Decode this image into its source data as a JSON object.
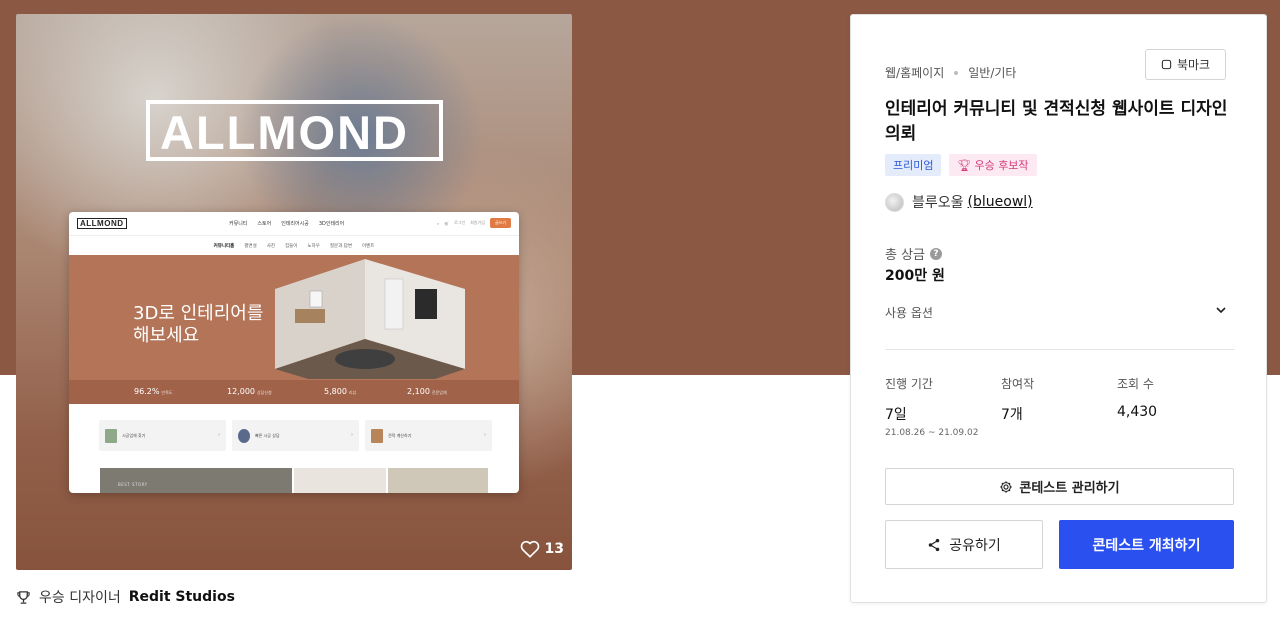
{
  "preview": {
    "logo": "ALLMOND",
    "mock": {
      "logo": "ALLMOND",
      "menu": [
        "커뮤니티",
        "스토어",
        "인테리어시공",
        "3D인테리어"
      ],
      "nav_right": [
        "로그인",
        "회원가입"
      ],
      "cta": "글쓰기",
      "submenu": [
        "커뮤니티홈",
        "평면설",
        "사진",
        "집들이",
        "노하우",
        "질문과 답변",
        "이벤트"
      ],
      "hero_title": "3D로 인테리어를\n해보세요",
      "stats": [
        {
          "value": "96.2%",
          "unit": "만족도"
        },
        {
          "value": "12,000",
          "unit": "상담신청"
        },
        {
          "value": "5,800",
          "unit": "리뷰"
        },
        {
          "value": "2,100",
          "unit": "전문업체"
        }
      ],
      "cards": [
        {
          "label": "시공업체 찾기"
        },
        {
          "label": "빠른 시공 상담"
        },
        {
          "label": "견적 계산하기"
        }
      ],
      "thumb_label": "BEST STORY"
    },
    "likes": "13"
  },
  "designer": {
    "prefix": "우승 디자이너",
    "name": "Redit Studios"
  },
  "panel": {
    "categories": [
      "웹/홈페이지",
      "일반/기타"
    ],
    "bookmark_label": "북마크",
    "title": "인테리어 커뮤니티 및 견적신청 웹사이트 디자인 의뢰",
    "badges": {
      "premium": "프리미엄",
      "award": "우승 후보작"
    },
    "author": {
      "name": "블루오울",
      "handle": "(blueowl)"
    },
    "prize_label": "총 상금",
    "prize_value": "200만 원",
    "options_label": "사용 옵션",
    "stats": {
      "period_label": "진행 기간",
      "period_value": "7일",
      "period_range": "21.08.26 ~ 21.09.02",
      "entries_label": "참여작",
      "entries_value": "7개",
      "views_label": "조회 수",
      "views_value": "4,430"
    },
    "manage_label": "콘테스트 관리하기",
    "share_label": "공유하기",
    "host_label": "콘테스트 개최하기"
  }
}
